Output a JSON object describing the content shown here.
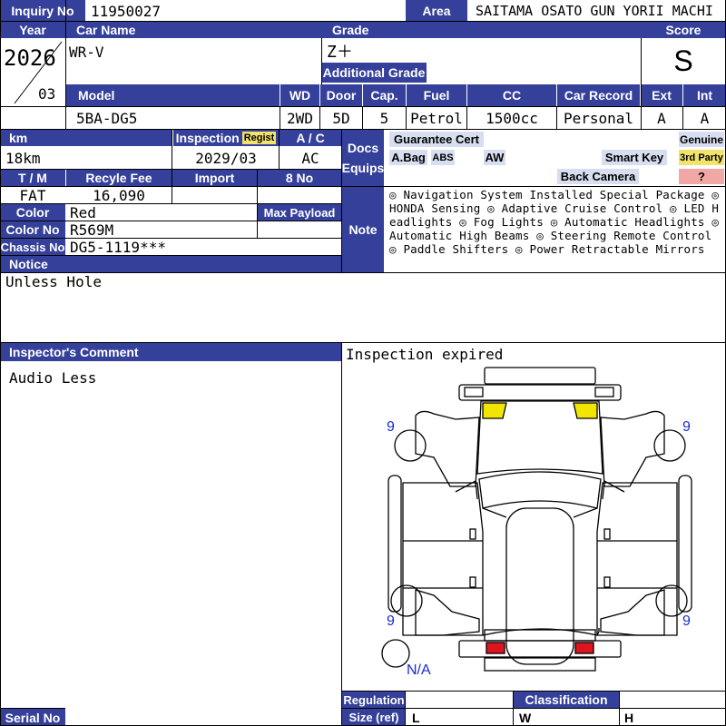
{
  "inquiry": {
    "label": "Inquiry No",
    "value": "11950027"
  },
  "area": {
    "label": "Area",
    "value": "SAITAMA OSATO GUN YORII MACHI"
  },
  "year": {
    "label": "Year",
    "value": "2026",
    "month": "03"
  },
  "car_name": {
    "label": "Car Name",
    "value": "WR-V"
  },
  "grade": {
    "label": "Grade",
    "value": "Z＋",
    "additional_label": "Additional Grade",
    "additional_value": ""
  },
  "score": {
    "label": "Score",
    "value": "S"
  },
  "spec_headers": {
    "model": "Model",
    "wd": "WD",
    "door": "Door",
    "cap": "Cap.",
    "fuel": "Fuel",
    "cc": "CC",
    "record": "Car Record",
    "ext": "Ext",
    "int": "Int"
  },
  "spec_values": {
    "model": "5BA-DG5",
    "wd": "2WD",
    "door": "5D",
    "cap": "5",
    "fuel": "Petrol",
    "cc": "1500cc",
    "record": "Personal",
    "ext": "A",
    "int": "A"
  },
  "km": {
    "label": "km",
    "value": "18km"
  },
  "inspection": {
    "label": "Inspection",
    "badge": "Regist",
    "value": "2029/03"
  },
  "ac": {
    "label": "A / C",
    "value": "AC"
  },
  "docs": {
    "label_line1": "Docs",
    "label_line2": "Equips"
  },
  "equip_tags": {
    "guarantee": "Guarantee Cert",
    "genuine": "Genuine",
    "abag": "A.Bag",
    "abs": "ABS",
    "aw": "AW",
    "smart_key": "Smart Key",
    "third_party": "3rd Party",
    "back_camera": "Back Camera",
    "question": "?"
  },
  "tm": {
    "label": "T / M",
    "value": "FAT"
  },
  "recycle": {
    "label": "Recyle Fee",
    "value": "16,090"
  },
  "import": {
    "label": "Import",
    "value": ""
  },
  "eight_no": {
    "label": "8 No",
    "value": ""
  },
  "color": {
    "label": "Color",
    "value": "Red"
  },
  "max_payload": {
    "label": "Max Payload",
    "value": ""
  },
  "color_no": {
    "label": "Color No",
    "value": "R569M"
  },
  "chassis": {
    "label": "Chassis No",
    "value": "DG5-1119***"
  },
  "note": {
    "label": "Note",
    "text": "◎ Navigation System Installed Special Package ◎ HONDA Sensing ◎ Adaptive Cruise Control ◎ LED Headlights ◎ Fog Lights ◎ Automatic Headlights ◎ Automatic High Beams ◎ Steering Remote Control ◎ Paddle Shifters ◎ Power Retractable Mirrors"
  },
  "notice": {
    "label": "Notice",
    "value": "Unless Hole"
  },
  "inspector": {
    "label": "Inspector's Comment",
    "value": "Audio Less"
  },
  "inspection_status": "Inspection expired",
  "diagram": {
    "marks": {
      "front_left": "9",
      "front_right": "9",
      "rear_left": "9",
      "rear_right": "9",
      "spare": "N/A"
    },
    "colors": {
      "headlight": "#f2e600",
      "taillight": "#e0141e",
      "pen": "#1a2bd4"
    }
  },
  "footer": {
    "serial_label": "Serial No",
    "regulation_label": "Regulation",
    "size_label": "Size (ref)",
    "classification_label": "Classification",
    "l": "L",
    "w": "W",
    "h": "H"
  }
}
